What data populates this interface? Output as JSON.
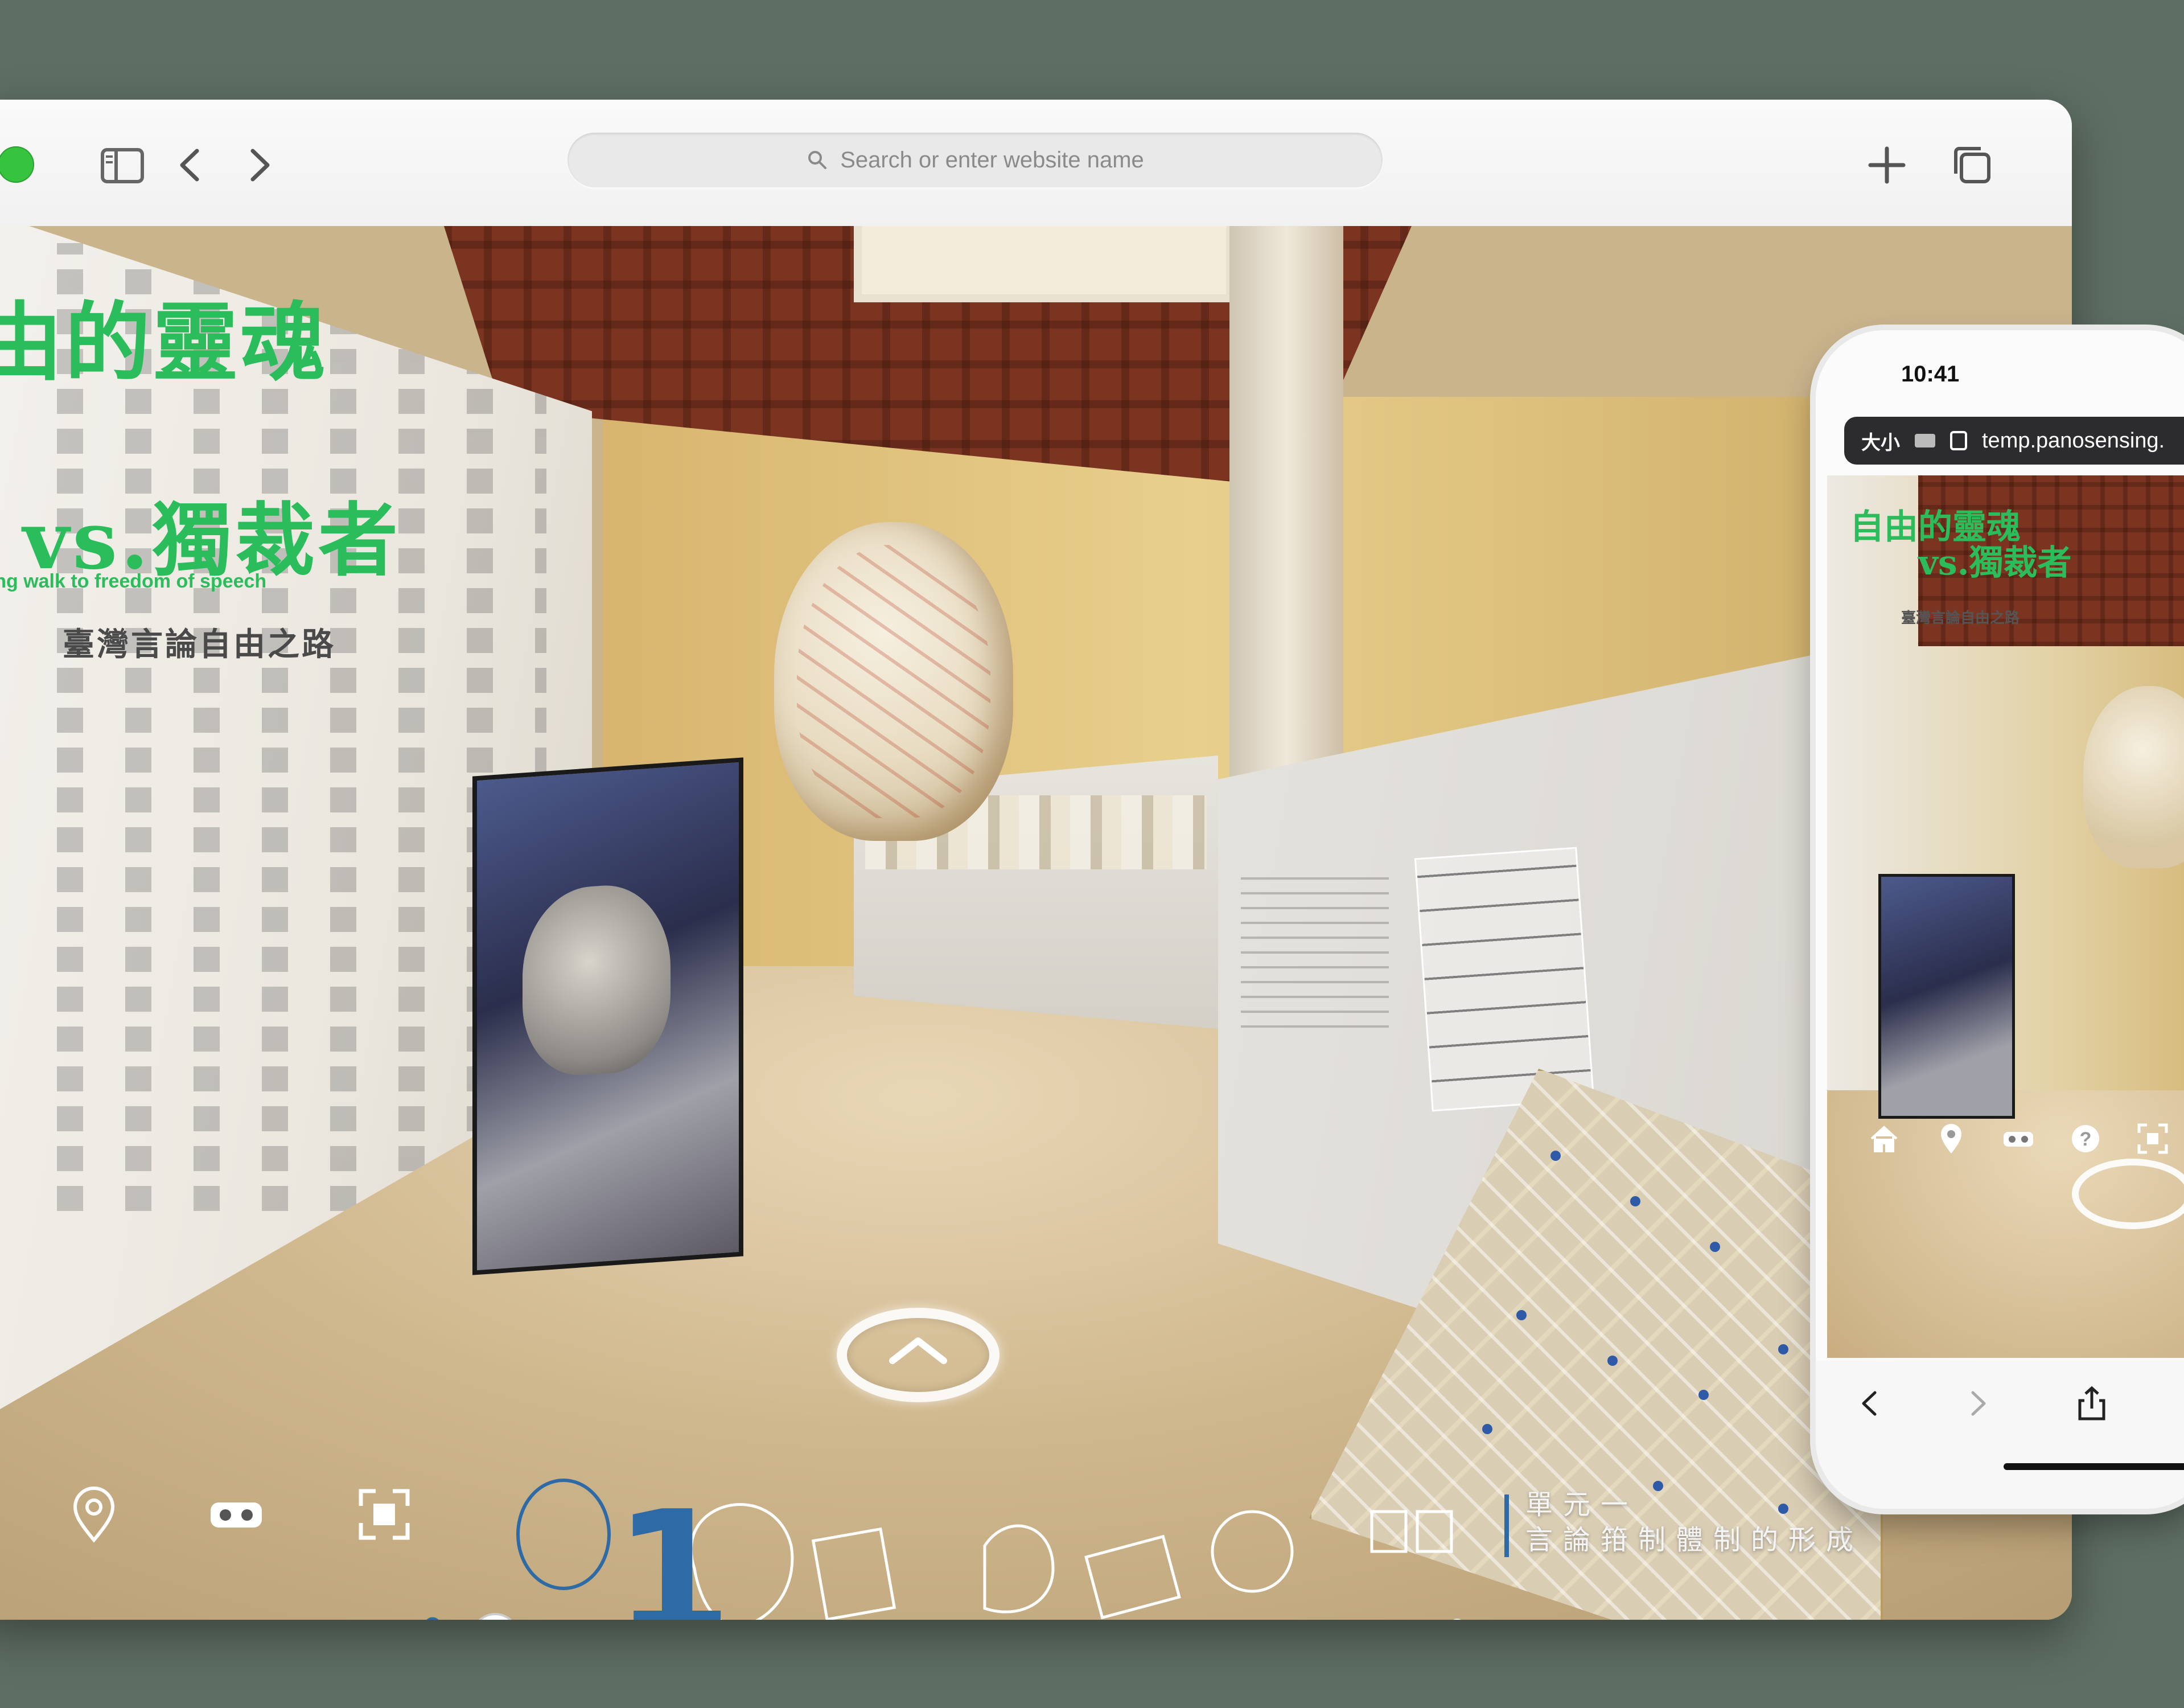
{
  "browser": {
    "address_placeholder": "Search or enter website name",
    "toolbar_icons": [
      "sidebar-icon",
      "back-icon",
      "forward-icon",
      "new-tab-icon",
      "tabs-overview-icon"
    ]
  },
  "exhibit": {
    "wall_title_line1": "由的靈魂",
    "wall_title_line2": "vs.獨裁者",
    "wall_subtitle_en": "long walk to freedom of speech",
    "wall_subtitle_zh": "臺灣言論自由之路",
    "unit_number": "1",
    "unit_label_line1": "單元一",
    "unit_label_line2": "言論箝制體制的形成"
  },
  "hud": {
    "icons": [
      "location-pin-icon",
      "vr-headset-icon",
      "fullscreen-icon",
      "help-icon"
    ]
  },
  "phone": {
    "time": "10:41",
    "text_size_label": "大小",
    "url": "temp.panosensing.",
    "title_line1": "自由的靈魂",
    "title_line2": "vs.獨裁者",
    "subtitle": "臺灣言論自由之路",
    "hud_icons": [
      "home-icon",
      "location-pin-icon",
      "vr-headset-icon",
      "help-icon",
      "fullscreen-icon"
    ],
    "nav_icons": [
      "back-icon",
      "forward-icon",
      "share-icon"
    ]
  },
  "colors": {
    "accent_green": "#2bbd5b",
    "unit_blue": "#2d6aa6",
    "background": "#5e6e62"
  }
}
